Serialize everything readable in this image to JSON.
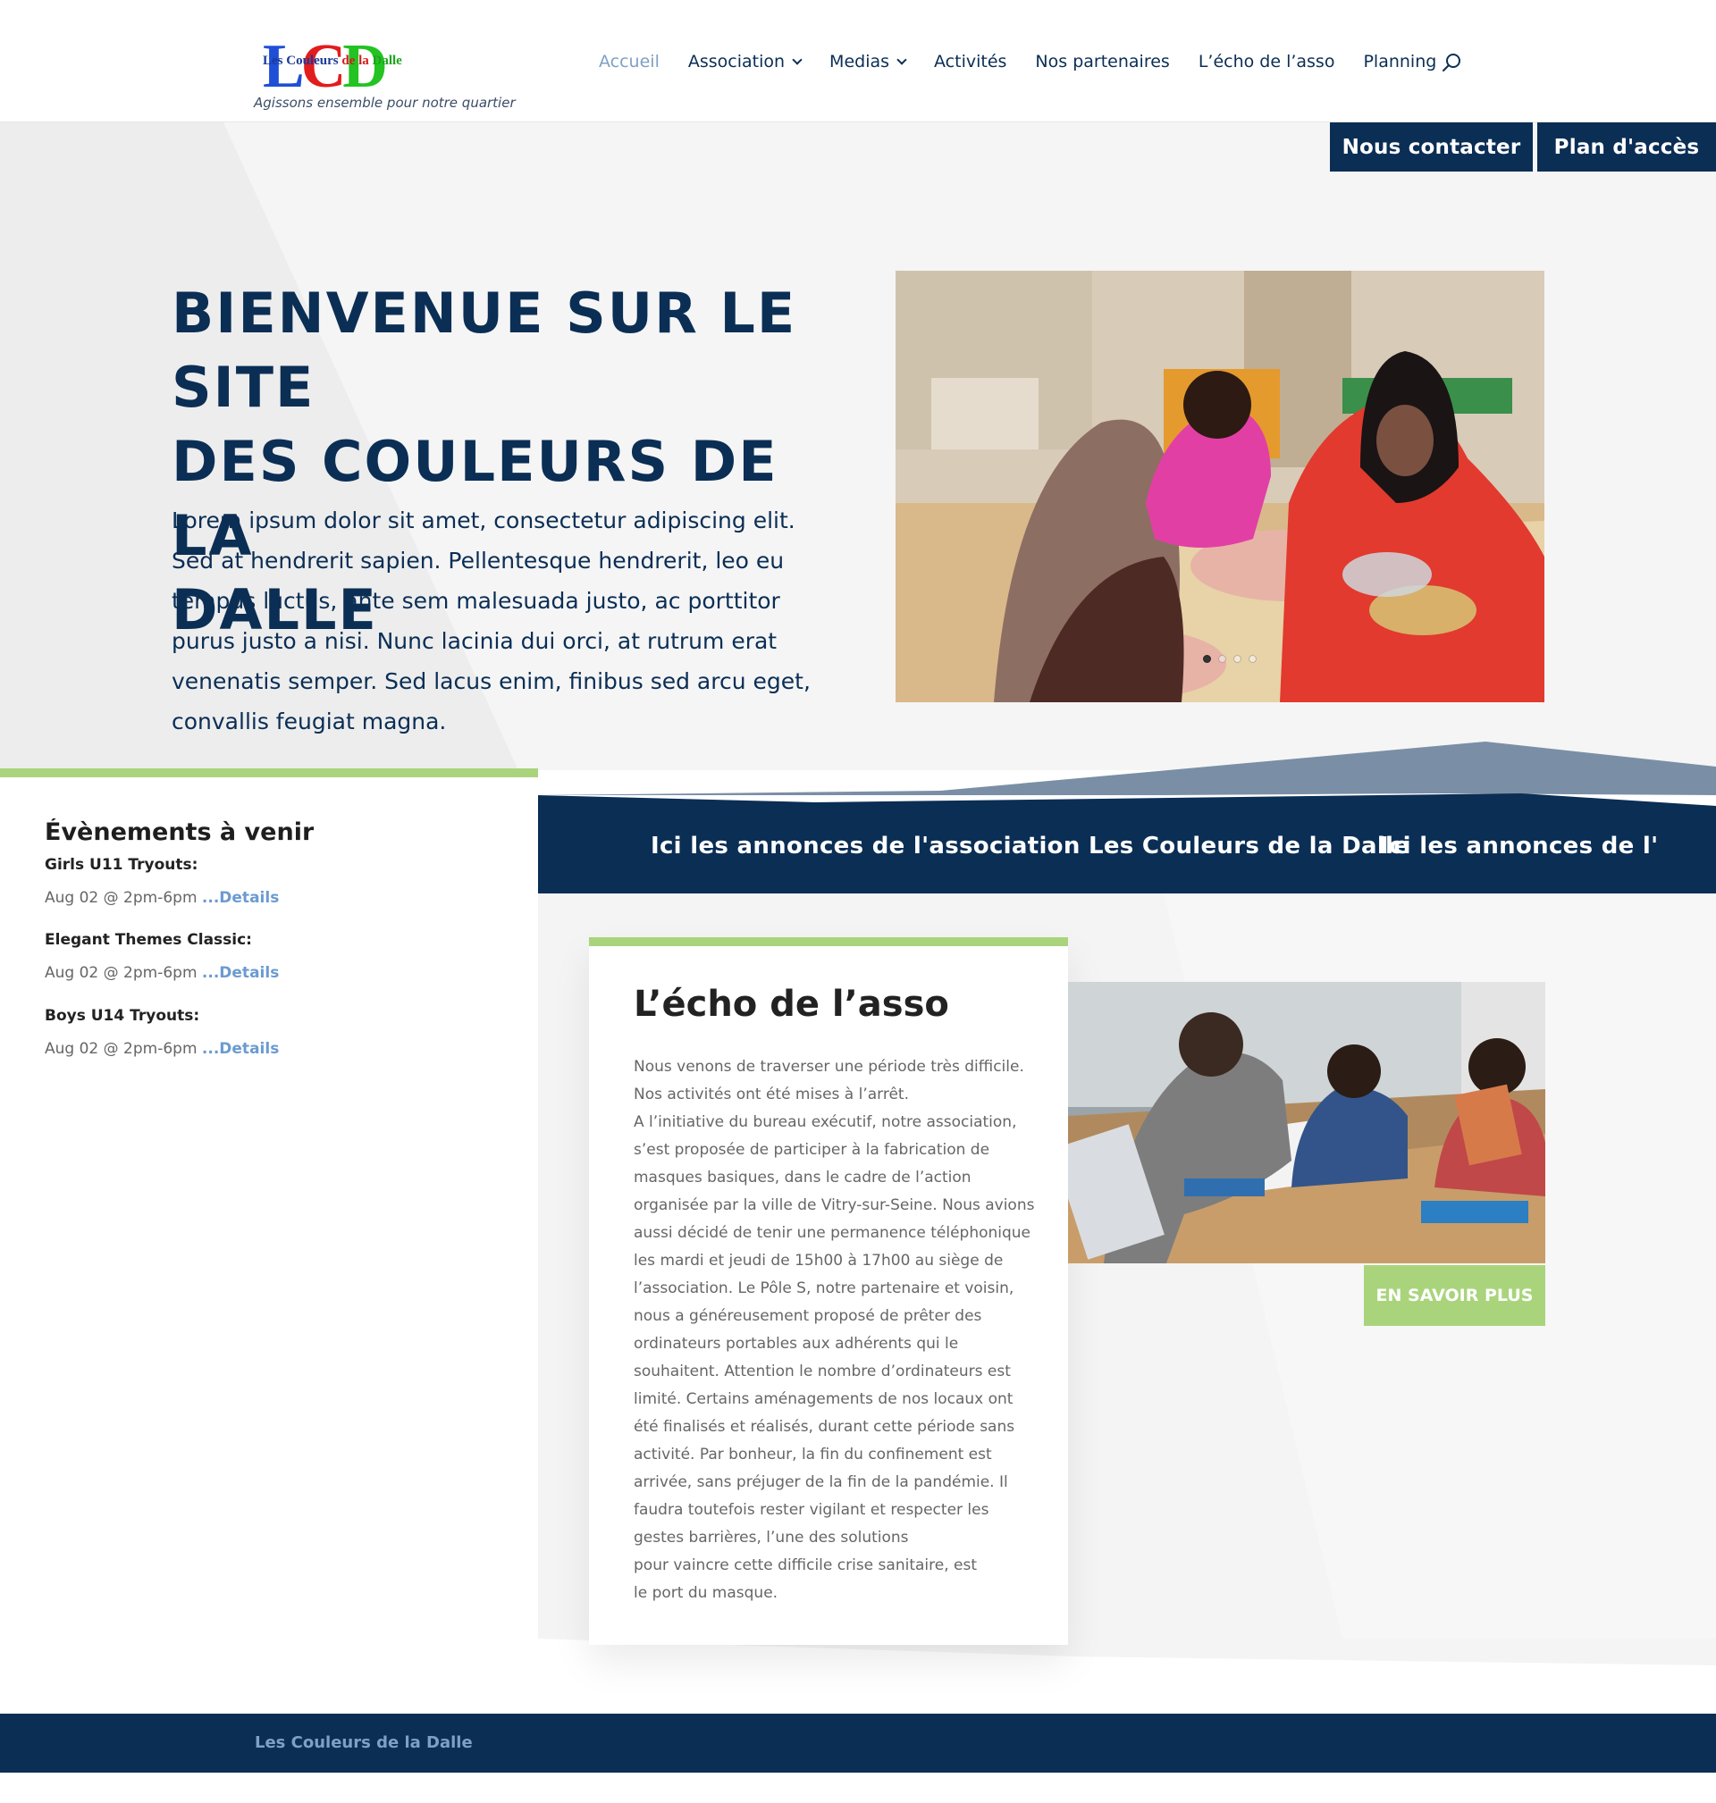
{
  "header": {
    "logo_letters": [
      "L",
      "C",
      "D"
    ],
    "logo_text_parts": [
      "Les Couleurs ",
      "de la ",
      "Dalle"
    ],
    "tagline": "Agissons ensemble pour notre quartier",
    "nav": [
      {
        "label": "Accueil",
        "active": true,
        "has_dropdown": false
      },
      {
        "label": "Association",
        "active": false,
        "has_dropdown": true
      },
      {
        "label": "Medias",
        "active": false,
        "has_dropdown": true
      },
      {
        "label": "Activités",
        "active": false,
        "has_dropdown": false
      },
      {
        "label": "Nos partenaires",
        "active": false,
        "has_dropdown": false
      },
      {
        "label": "L’écho de l’asso",
        "active": false,
        "has_dropdown": false
      },
      {
        "label": "Planning",
        "active": false,
        "has_dropdown": false
      }
    ],
    "search_icon": "search-icon"
  },
  "cta": {
    "contact_label": "Nous contacter",
    "map_label": "Plan d'accès"
  },
  "hero": {
    "title_lines": [
      "BIENVENUE SUR LE SITE",
      "DES COULEURS DE LA",
      "DALLE"
    ],
    "text": "Lorem ipsum dolor sit amet, consectetur adipiscing elit. Sed at hendrerit sapien. Pellentesque hendrerit, leo eu tempus luctus, ante sem malesuada justo, ac porttitor purus justo a nisi. Nunc lacinia dui orci, at rutrum erat venenatis semper. Sed lacus enim, finibus sed arcu eget, convallis feugiat magna.",
    "slider_count": 4,
    "slider_active": 1
  },
  "events": {
    "title": "Évènements à venir",
    "items": [
      {
        "title": "Girls U11 Tryouts:",
        "meta": "Aug 02 @ 2pm-6pm ",
        "link": "...Details"
      },
      {
        "title": "Elegant Themes Classic:",
        "meta": "Aug 02 @ 2pm-6pm ",
        "link": "...Details"
      },
      {
        "title": "Boys U14 Tryouts:",
        "meta": "Aug 02 @ 2pm-6pm ",
        "link": "...Details"
      }
    ]
  },
  "announce": {
    "text": "Ici les annonces de l'association Les Couleurs de la Dalle",
    "text_partial": "Ici les annonces de l'"
  },
  "echo": {
    "title": "L’écho de l’asso",
    "paragraphs": [
      "Nous venons de traverser une période très difficile. Nos activités ont été mises à l’arrêt.",
      "A l’initiative du bureau exécutif, notre association, s’est proposée de participer à la fabrication de masques basiques, dans le cadre de l’action organisée par la ville de Vitry-sur-Seine. Nous avions aussi décidé de tenir une permanence téléphonique les mardi et jeudi de 15h00 à 17h00 au siège de l’association. Le Pôle S, notre partenaire et voisin, nous a généreusement proposé de prêter des ordinateurs portables aux adhérents qui le souhaitent. Attention le nombre d’ordinateurs est limité. Certains aménagements de nos locaux ont été finalisés et réalisés, durant cette période sans activité. Par bonheur, la fin du confinement est arrivée, sans préjuger de la fin de la pandémie. Il faudra toutefois rester vigilant et respecter les gestes barrières, l’une des solutions",
      "pour vaincre cette difficile crise sanitaire, est",
      "le port du masque."
    ],
    "button_label": "En savoir plus"
  },
  "footer": {
    "text": "Les Couleurs de la Dalle"
  },
  "colors": {
    "navy": "#0b2e55",
    "green": "#a9d47c",
    "link_blue": "#6b9bd1",
    "slate": "#7a8fa6"
  }
}
